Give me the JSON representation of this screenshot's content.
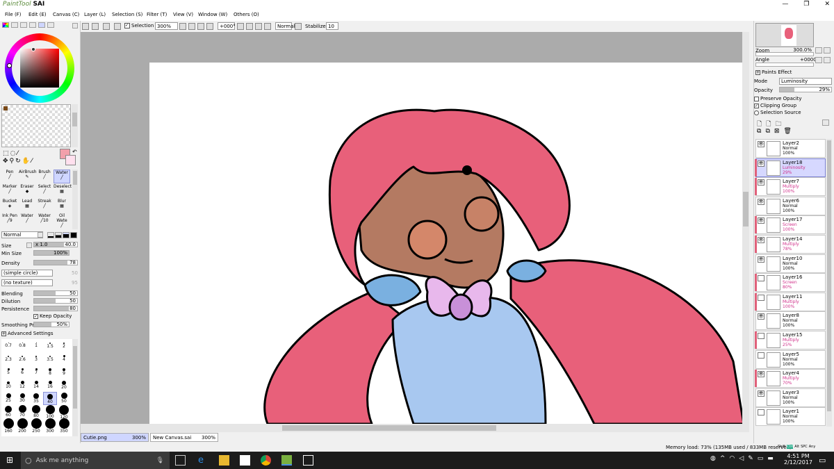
{
  "app": {
    "logo_small": "PaintTool",
    "logo_big": "SAI"
  },
  "window_controls": [
    "—",
    "❐",
    "✕"
  ],
  "menu": [
    {
      "label": "File (F)"
    },
    {
      "label": "Edit (E)"
    },
    {
      "label": "Canvas (C)"
    },
    {
      "label": "Layer (L)"
    },
    {
      "label": "Selection (S)"
    },
    {
      "label": "Filter (T)"
    },
    {
      "label": "View (V)"
    },
    {
      "label": "Window (W)"
    },
    {
      "label": "Others (O)"
    }
  ],
  "toolbar": {
    "selection_label": "Selection",
    "zoom": "300%",
    "rotation": "+000°",
    "mode": "Normal",
    "stabilizer_label": "Stabilizer",
    "stabilizer": "10"
  },
  "left": {
    "primary_color": "#f2a0ab",
    "tools": [
      {
        "label": "Pen",
        "sel": false
      },
      {
        "label": "AirBrush",
        "sel": false
      },
      {
        "label": "Brush",
        "sel": false
      },
      {
        "label": "Water",
        "sel": true
      },
      {
        "label": "Marker",
        "sel": false
      },
      {
        "label": "Eraser",
        "sel": false
      },
      {
        "label": "Select",
        "sel": false
      },
      {
        "label": "Deselect",
        "sel": false
      },
      {
        "label": "Bucket",
        "sel": false
      },
      {
        "label": "Lead",
        "sel": false
      },
      {
        "label": "Streak",
        "sel": false
      },
      {
        "label": "Blur",
        "sel": false
      },
      {
        "label": "Ink Pen",
        "sel": false
      },
      {
        "label": "Water",
        "sel": false
      },
      {
        "label": "Water",
        "sel": false
      },
      {
        "label": "Oil Wate",
        "sel": false
      }
    ],
    "tool_sizes": [
      "9",
      "",
      "10",
      ""
    ],
    "blend_mode": "Normal",
    "size_label": "Size",
    "size_mult": "x 1.0",
    "size_value": "40.0",
    "minsize_label": "Min Size",
    "minsize_value": "100%",
    "density_label": "Density",
    "density_value": "78",
    "shape": "(simple circle)",
    "shape_val": "50",
    "texture": "(no texture)",
    "texture_val": "95",
    "blending_label": "Blending",
    "blending_value": "50",
    "dilution_label": "Dilution",
    "dilution_value": "50",
    "persistence_label": "Persistence",
    "persistence_value": "80",
    "keep_opacity": "Keep Opacity",
    "smoothing_label": "Smoothing Prs",
    "smoothing_value": "50%",
    "advanced": "Advanced Settings",
    "brush_sizes": [
      "0.7",
      "0.8",
      "1",
      "1.5",
      "2",
      "2.3",
      "2.6",
      "3",
      "3.5",
      "4",
      "5",
      "6",
      "7",
      "8",
      "9",
      "10",
      "12",
      "14",
      "16",
      "20",
      "25",
      "30",
      "35",
      "40",
      "50",
      "60",
      "70",
      "80",
      "100",
      "120",
      "160",
      "200",
      "250",
      "300",
      "350"
    ]
  },
  "right": {
    "zoom_label": "Zoom",
    "zoom_value": "300.0%",
    "angle_label": "Angle",
    "angle_value": "+0000",
    "paints_effect": "Paints Effect",
    "mode_label": "Mode",
    "mode_value": "Luminosity",
    "opacity_label": "Opacity",
    "opacity_value": "29%",
    "preserve_opacity": "Preserve Opacity",
    "clipping_group": "Clipping Group",
    "selection_source": "Selection Source",
    "layers": [
      {
        "name": "Layer2",
        "mode": "Normal",
        "opacity": "100%",
        "clip": false,
        "sel": false,
        "eye": true
      },
      {
        "name": "Layer18",
        "mode": "Luminosity",
        "opacity": "29%",
        "clip": true,
        "sel": true,
        "eye": true
      },
      {
        "name": "Layer7",
        "mode": "Multiply",
        "opacity": "100%",
        "clip": true,
        "sel": false,
        "eye": true
      },
      {
        "name": "Layer6",
        "mode": "Normal",
        "opacity": "100%",
        "clip": false,
        "sel": false,
        "eye": true
      },
      {
        "name": "Layer17",
        "mode": "Screen",
        "opacity": "100%",
        "clip": true,
        "sel": false,
        "eye": true
      },
      {
        "name": "Layer14",
        "mode": "Multiply",
        "opacity": "78%",
        "clip": true,
        "sel": false,
        "eye": true
      },
      {
        "name": "Layer10",
        "mode": "Normal",
        "opacity": "100%",
        "clip": false,
        "sel": false,
        "eye": true
      },
      {
        "name": "Layer16",
        "mode": "Screen",
        "opacity": "80%",
        "clip": true,
        "sel": false,
        "eye": false
      },
      {
        "name": "Layer11",
        "mode": "Multiply",
        "opacity": "100%",
        "clip": true,
        "sel": false,
        "eye": false
      },
      {
        "name": "Layer8",
        "mode": "Normal",
        "opacity": "100%",
        "clip": false,
        "sel": false,
        "eye": true
      },
      {
        "name": "Layer15",
        "mode": "Multiply",
        "opacity": "25%",
        "clip": true,
        "sel": false,
        "eye": false
      },
      {
        "name": "Layer5",
        "mode": "Normal",
        "opacity": "100%",
        "clip": false,
        "sel": false,
        "eye": false
      },
      {
        "name": "Layer4",
        "mode": "Multiply",
        "opacity": "70%",
        "clip": true,
        "sel": false,
        "eye": true
      },
      {
        "name": "Layer3",
        "mode": "Normal",
        "opacity": "100%",
        "clip": false,
        "sel": false,
        "eye": true
      },
      {
        "name": "Layer1",
        "mode": "Normal",
        "opacity": "100%",
        "clip": false,
        "sel": false,
        "eye": false
      }
    ]
  },
  "tabs": [
    {
      "name": "Cutie.png",
      "zoom": "300%",
      "active": true
    },
    {
      "name": "New Canvas.sai",
      "zoom": "300%",
      "active": false
    }
  ],
  "status": {
    "memory": "Memory load: 73% (135MB used / 833MB reserved)",
    "keys": [
      "Shift",
      "Ctrl",
      "Alt",
      "SPC",
      "Any"
    ]
  },
  "taskbar": {
    "search_placeholder": "Ask me anything",
    "time": "4:51 PM",
    "date": "2/12/2017"
  },
  "colors": {
    "hair": "#e8607a",
    "skin": "#b47a62",
    "shirt": "#a8c8f0",
    "bow": "#e8b8ec",
    "accent": "#8c94d8"
  }
}
